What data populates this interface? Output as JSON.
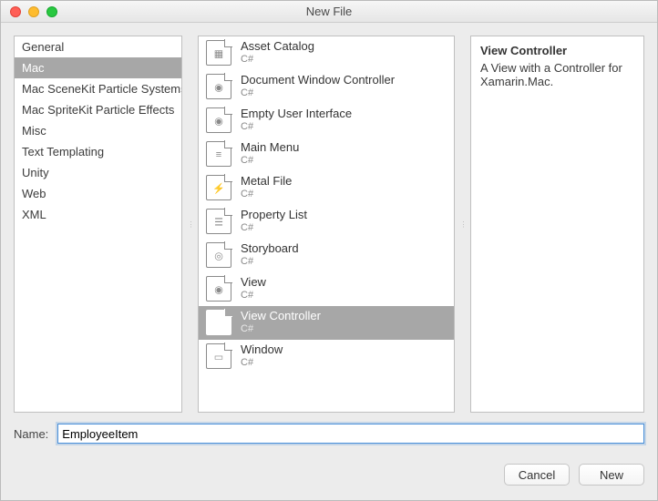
{
  "title": "New File",
  "categories": [
    {
      "label": "General",
      "selected": false
    },
    {
      "label": "Mac",
      "selected": true
    },
    {
      "label": "Mac SceneKit Particle Systems",
      "selected": false
    },
    {
      "label": "Mac SpriteKit Particle Effects",
      "selected": false
    },
    {
      "label": "Misc",
      "selected": false
    },
    {
      "label": "Text Templating",
      "selected": false
    },
    {
      "label": "Unity",
      "selected": false
    },
    {
      "label": "Web",
      "selected": false
    },
    {
      "label": "XML",
      "selected": false
    }
  ],
  "templates": [
    {
      "label": "Asset Catalog",
      "sub": "C#",
      "icon": "grid",
      "selected": false
    },
    {
      "label": "Document Window Controller",
      "sub": "C#",
      "icon": "eye",
      "selected": false
    },
    {
      "label": "Empty User Interface",
      "sub": "C#",
      "icon": "eye",
      "selected": false
    },
    {
      "label": "Main Menu",
      "sub": "C#",
      "icon": "lines",
      "selected": false
    },
    {
      "label": "Metal File",
      "sub": "C#",
      "icon": "metal",
      "selected": false
    },
    {
      "label": "Property List",
      "sub": "C#",
      "icon": "list",
      "selected": false
    },
    {
      "label": "Storyboard",
      "sub": "C#",
      "icon": "storyboard",
      "selected": false
    },
    {
      "label": "View",
      "sub": "C#",
      "icon": "eye",
      "selected": false
    },
    {
      "label": "View Controller",
      "sub": "C#",
      "icon": "eye",
      "selected": true
    },
    {
      "label": "Window",
      "sub": "C#",
      "icon": "window",
      "selected": false
    }
  ],
  "detail": {
    "heading": "View Controller",
    "description": "A View with a Controller for Xamarin.Mac."
  },
  "name_label": "Name:",
  "name_value": "EmployeeItem",
  "buttons": {
    "cancel": "Cancel",
    "new": "New"
  }
}
